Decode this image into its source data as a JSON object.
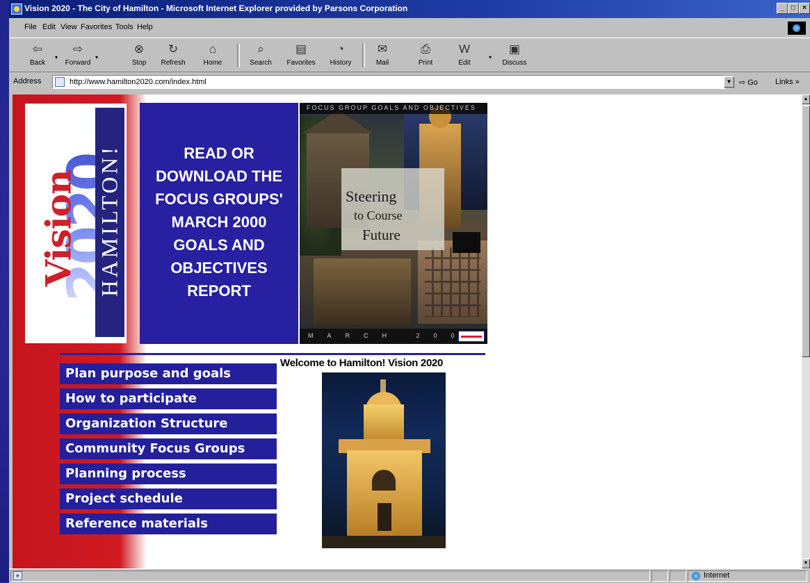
{
  "window": {
    "title": "Vision 2020 - The City of Hamilton - Microsoft Internet Explorer provided by Parsons Corporation",
    "controls": [
      "_",
      "□",
      "×"
    ]
  },
  "menu": [
    "File",
    "Edit",
    "View",
    "Favorites",
    "Tools",
    "Help"
  ],
  "toolbar": [
    {
      "label": "Back",
      "icon": "back-arrow-icon",
      "glyph": "⇦"
    },
    {
      "label": "Forward",
      "icon": "forward-arrow-icon",
      "glyph": "⇨"
    },
    {
      "label": "Stop",
      "icon": "stop-icon",
      "glyph": "⊗"
    },
    {
      "label": "Refresh",
      "icon": "refresh-icon",
      "glyph": "↻"
    },
    {
      "label": "Home",
      "icon": "home-icon",
      "glyph": "⌂"
    },
    {
      "label": "Search",
      "icon": "search-icon",
      "glyph": "⌕"
    },
    {
      "label": "Favorites",
      "icon": "favorites-folder-icon",
      "glyph": "▤"
    },
    {
      "label": "History",
      "icon": "history-icon",
      "glyph": "◔"
    },
    {
      "label": "Mail",
      "icon": "mail-icon",
      "glyph": "✉"
    },
    {
      "label": "Print",
      "icon": "printer-icon",
      "glyph": "⎙"
    },
    {
      "label": "Edit",
      "icon": "edit-word-icon",
      "glyph": "W"
    },
    {
      "label": "Discuss",
      "icon": "discuss-icon",
      "glyph": "▣"
    }
  ],
  "address": {
    "label": "Address",
    "url": "http://www.hamilton2020.com/index.html",
    "go": "Go",
    "links": "Links »"
  },
  "logo": {
    "word": "Vision",
    "year": "2020",
    "city": "HAMILTON!"
  },
  "promo": {
    "lines": [
      "READ OR",
      "DOWNLOAD THE",
      "FOCUS GROUPS'",
      "MARCH 2000",
      "GOALS AND",
      "OBJECTIVES",
      "REPORT"
    ]
  },
  "cover": {
    "header": "FOCUS GROUP GOALS AND OBJECTIVES",
    "line1": "Steering",
    "line2": "to Course",
    "line3": "Future",
    "footer": "MARCH 2000"
  },
  "welcome": "Welcome to Hamilton! Vision 2020",
  "nav": [
    "Plan purpose and goals",
    "How to participate",
    "Organization Structure",
    "Community Focus Groups",
    "Planning process",
    "Project schedule",
    "Reference materials"
  ],
  "status": {
    "zone": "Internet"
  }
}
